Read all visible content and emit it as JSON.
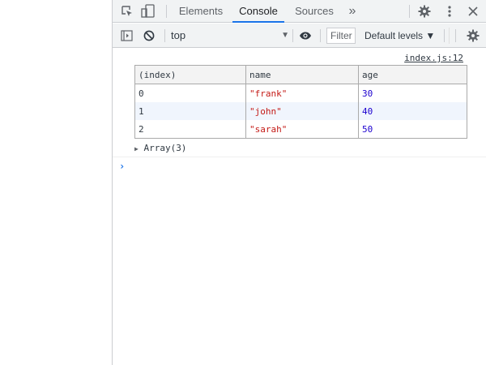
{
  "tabs": {
    "elements": "Elements",
    "console": "Console",
    "sources": "Sources",
    "more": "»"
  },
  "toolbar": {
    "context": "top",
    "filter_placeholder": "Filter",
    "levels": "Default levels ▼"
  },
  "console": {
    "source_link": "index.js:12",
    "table": {
      "headers": [
        "(index)",
        "name",
        "age"
      ],
      "rows": [
        {
          "index": "0",
          "name": "\"frank\"",
          "age": "30"
        },
        {
          "index": "1",
          "name": "\"john\"",
          "age": "40"
        },
        {
          "index": "2",
          "name": "\"sarah\"",
          "age": "50"
        }
      ]
    },
    "array_summary": "Array(3)",
    "prompt": "›"
  },
  "colors": {
    "accent": "#1a73e8",
    "string": "#c41a16",
    "number": "#1c00cf",
    "alt_row": "#f0f5fd"
  }
}
